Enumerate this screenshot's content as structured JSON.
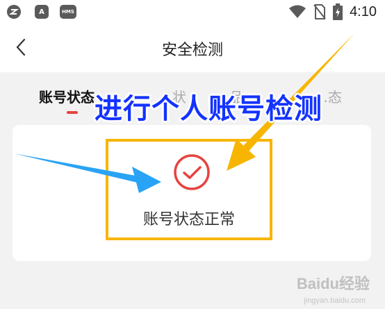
{
  "statusbar": {
    "app_icons": [
      "app-icon",
      "A",
      "HMS"
    ],
    "time": "4:10"
  },
  "header": {
    "title": "安全检测"
  },
  "tabs": [
    {
      "label": "账号状态",
      "active": true
    },
    {
      "label": "…状",
      "active": false
    },
    {
      "label": "…品…",
      "active": false
    },
    {
      "label": "…态",
      "active": false
    }
  ],
  "result": {
    "text": "账号状态正常",
    "icon": "check-circle-icon",
    "icon_color": "#e64340"
  },
  "annotation": {
    "text": "进行个人账号检测",
    "color": "#1433ff",
    "highlight_color": "#f7b500",
    "arrow_colors": [
      "#29a3f5",
      "#f7b500"
    ]
  },
  "watermark": {
    "brand": "Baidu经验",
    "url": "jingyan.baidu.com"
  }
}
